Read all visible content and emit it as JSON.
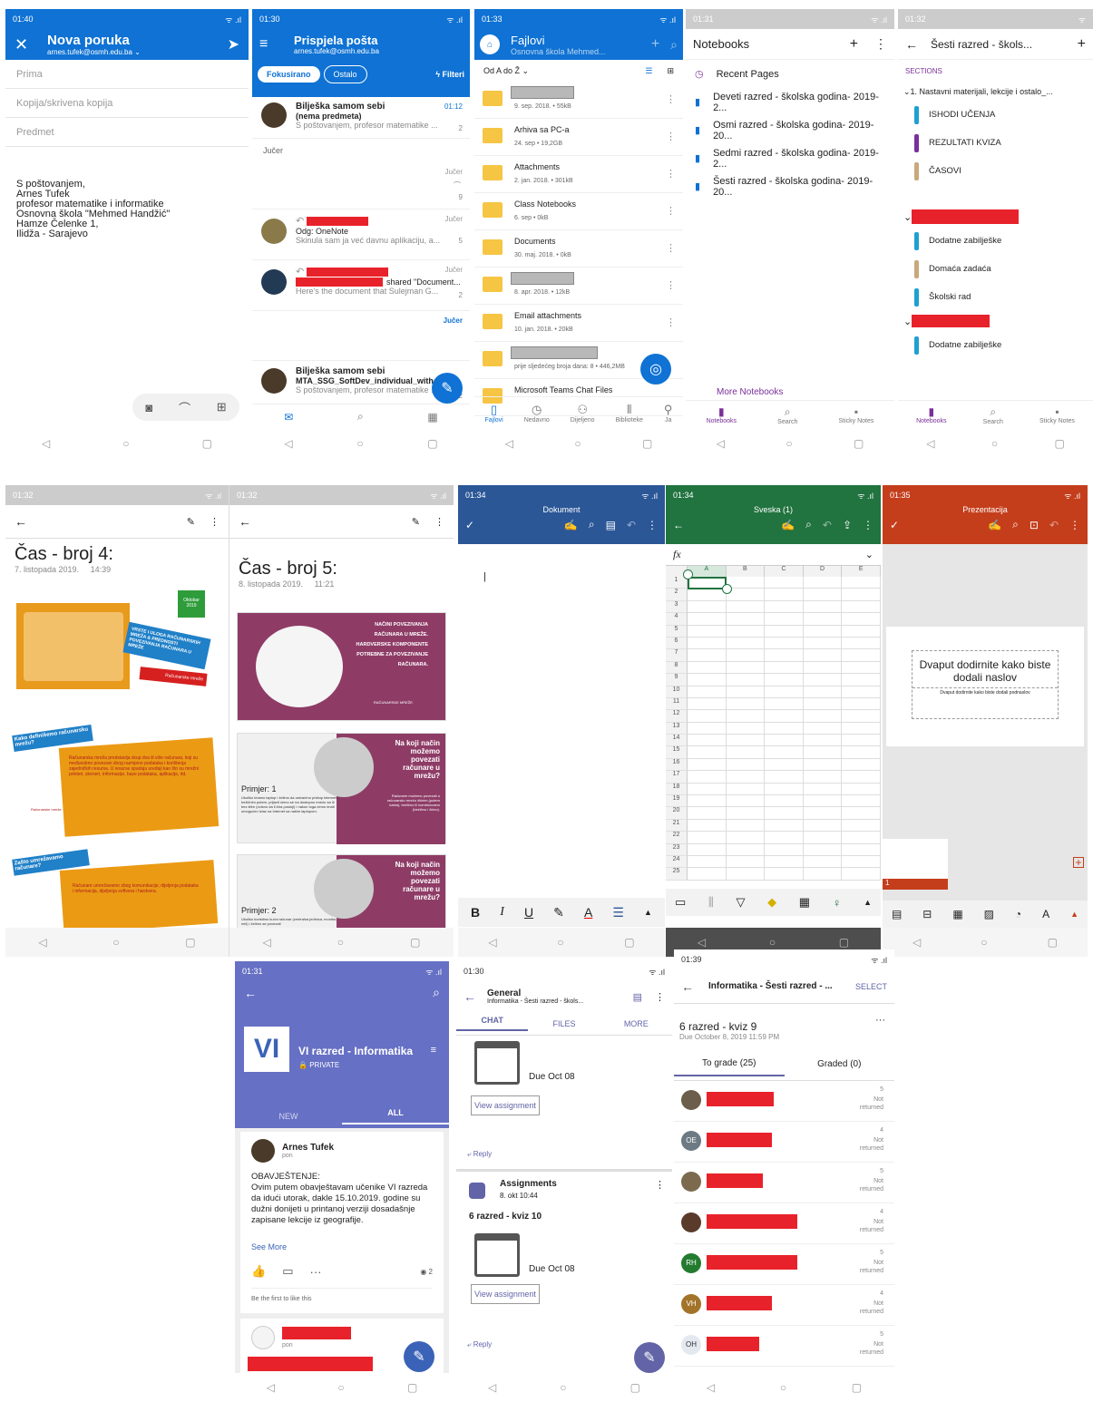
{
  "compose": {
    "time": "01:40",
    "title": "Nova poruka",
    "from": "arnes.tufek@osmh.edu.ba",
    "to": "Prima",
    "cc": "Kopija/skrivena kopija",
    "subject": "Predmet",
    "sig": [
      "S poštovanjem,",
      "Arnes Tufek",
      "profesor matematike i informatike",
      "Osnovna škola \"Mehmed Handžić\"",
      "Hamze Čelenke 1,",
      "Ilidža - Sarajevo"
    ]
  },
  "inbox": {
    "time": "01:30",
    "title": "Prispjela pošta",
    "account": "arnes.tufek@osmh.edu.ba",
    "tab1": "Fokusirano",
    "tab2": "Ostalo",
    "filter": "Filteri",
    "m1": {
      "from": "Bilješka samom sebi",
      "subj": "(nema predmeta)",
      "prev": "S poštovanjem, profesor matematike ...",
      "time": "01:12",
      "count": "2"
    },
    "section": "Jučer",
    "m2": {
      "time": "Jučer",
      "count": "9"
    },
    "m3": {
      "subj": "Odg: OneNote",
      "prev": "Skinula sam ja već davnu aplikaciju, a...",
      "time": "Jučer",
      "count": "5"
    },
    "m4": {
      "subj": "shared \"Document...",
      "prev": "Here's the document that Sulejman G...",
      "time": "Jučer",
      "count": "2"
    },
    "m5time": "Jučer",
    "m6": {
      "from": "Bilješka samom sebi",
      "subj": "MTA_SSG_SoftDev_individual_with...",
      "prev": "S poštovanjem, profesor matematike ...",
      "count": "2"
    }
  },
  "files": {
    "time": "01:33",
    "title": "Fajlovi",
    "sub": "Osnovna škola Mehmed...",
    "sort": "Od A do Ž",
    "items": [
      {
        "name": "",
        "meta": "9. sep. 2018. • 55kB",
        "blur": true
      },
      {
        "name": "Arhiva sa PC-a",
        "meta": "24. sep • 19,2GB"
      },
      {
        "name": "Attachments",
        "meta": "2. jan. 2018. • 301kB"
      },
      {
        "name": "Class Notebooks",
        "meta": "6. sep • 0kB"
      },
      {
        "name": "Documents",
        "meta": "30. maj. 2018. • 0kB"
      },
      {
        "name": "",
        "meta": "8. apr. 2018. • 12kB",
        "blur": true
      },
      {
        "name": "Email attachments",
        "meta": "10. jan. 2018. • 20kB"
      },
      {
        "name": "",
        "meta": "prije sljedećeg broja dana: 8 • 446,2MB",
        "blur": true
      },
      {
        "name": "Microsoft Teams Chat Files",
        "meta": ""
      }
    ],
    "nav": [
      "Fajlovi",
      "Nedavno",
      "Dijeljeno",
      "Biblioteke",
      "Ja"
    ]
  },
  "notebooks": {
    "time": "01:31",
    "title": "Notebooks",
    "items": [
      "Recent Pages",
      "Deveti razred - školska godina- 2019-2...",
      "Osmi razred - školska godina- 2019-20...",
      "Sedmi razred - školska godina- 2019-2...",
      "Šesti razred - školska godina- 2019-20..."
    ],
    "more": "More Notebooks",
    "nav": [
      "Notebooks",
      "Search",
      "Sticky Notes"
    ]
  },
  "sections": {
    "time": "01:32",
    "title": "Šesti razred - škols...",
    "label": "SECTIONS",
    "group1": "1. Nastavni materijali, lekcije i ostalo_...",
    "g1items": [
      "ISHODI UČENJA",
      "REZULTATI KVIZA",
      "ČASOVI"
    ],
    "g2items": [
      "Dodatne zabilješke",
      "Domaća zadaća",
      "Školski rad"
    ],
    "g3items": [
      "Dodatne zabilješke"
    ],
    "nav": [
      "Notebooks",
      "Search",
      "Sticky Notes"
    ],
    "colors": [
      "#1fa0d0",
      "#7a2f9a",
      "#c9a87b",
      "#1fa0d0",
      "#c9a87b",
      "#1fa0d0",
      "#1fa0d0"
    ]
  },
  "cas4": {
    "time": "01:32",
    "title": "Čas - broj 4:",
    "date": "7. listopada 2019.",
    "clock": "14:39",
    "s1": {
      "tag": "Oktobar 2019",
      "banner": "VRSTE I ULOGA RAČUNARSKIH MREŽA & PREDNOSTI POVEZIVANJA RAČUNARA U MREŽE",
      "red": "Računarske mreže"
    },
    "s2": {
      "banner": "Kako definišemo računarsku mrežu?",
      "text": "Računarska mreža predstavlja skup dva ili više računara, koji su međusobno povezani zbog razmjene podataka i korištenja zajedničkih resursa. U resurse spadaju uređaji kao što su mrežni printeri, skeneri, informacije, baze podataka, aplikacije, itd.",
      "foot": "Računarske mreže",
      "num": "2"
    },
    "s3": {
      "banner": "Zašto umrežavamo računare?",
      "text": "Računare umrežavamo zbog komunikacije, dijeljenja podataka i informacija, dijeljenja softvera i hardvera."
    }
  },
  "cas5": {
    "time": "01:32",
    "title": "Čas - broj 5:",
    "date": "8. listopada 2019.",
    "clock": "11:21",
    "s1": {
      "text": "NAČINI POVEZIVANJA RAČUNARA U MREŽE. HARDVERSKE KOMPONENTE POTREBNE ZA POVEZIVANJE RAČUNARA.",
      "foot": "RAČUNARSKE MREŽE"
    },
    "s2": {
      "q": "Na koji način možemo povezati računare u mrežu?",
      "label": "Primjer: 1",
      "text": "Ukoliko imamo laptop i želimo da ostvarimo pristup internetu bežičnim putem, prijavit ćemo se na dostupnu mrežu sa ili bez šifre (ovisno da li bira postoji) i nakon toga ćemo imati omogućen izlaz na Internet sa našim laptopom.",
      "small": "Računare možemo povezati u računarsku mrežu žičnim (putem kabla), bežično ili kombinovano (bežično i žično)."
    },
    "s3": {
      "q": "Na koji način možemo povezati računare u mrežu?",
      "label": "Primjer: 2",
      "text": "Ukoliko koristimo kućni računar (centralna jedinica, monitor, miš) i želimo se povezati"
    }
  },
  "word": {
    "time": "01:34",
    "title": "Dokument",
    "bar": [
      "B",
      "I",
      "U"
    ]
  },
  "excel": {
    "time": "01:34",
    "title": "Sveska (1)",
    "fx": "fx",
    "cols": [
      "A",
      "B",
      "C",
      "D",
      "E"
    ],
    "rows": [
      "1",
      "2",
      "3",
      "4",
      "5",
      "6",
      "7",
      "8",
      "9",
      "10",
      "11",
      "12",
      "13",
      "14",
      "15",
      "16",
      "17",
      "18",
      "19",
      "20",
      "21",
      "22",
      "23",
      "24",
      "25"
    ]
  },
  "ppt": {
    "time": "01:35",
    "title": "Prezentacija",
    "slideTitle": "Dvaput dodirnite kako biste dodali naslov",
    "slideSub": "Dvaput dodirnite kako biste dodali podnaslov",
    "thumb": "1"
  },
  "yammer": {
    "time": "01:31",
    "logo": "VI",
    "group": "VI razred - Informatika",
    "privacy": "PRIVATE",
    "tabs": [
      "NEW",
      "ALL"
    ],
    "author": "Arnes Tufek",
    "day": "pon",
    "body": [
      "OBAVJEŠTENJE:",
      "Ovim putem obavještavam učenike VI razreda da idući utorak, dakle 15.10.2019. godine su dužni donijeti u printanoj verziji dosadašnje zapisane lekcije iz geografije."
    ],
    "more": "See More",
    "seen": "2",
    "like": "Be the first to like this",
    "day2": "pon"
  },
  "teamsChat": {
    "time": "01:30",
    "channel": "General",
    "sub": "Informatika - Šesti razred - škols...",
    "tabs": [
      "CHAT",
      "FILES",
      "MORE"
    ],
    "due1": "Due Oct 08",
    "view": "View assignment",
    "reply": "Reply",
    "app": "Assignments",
    "appTime": "8. okt 10:44",
    "quiz": "6 razred - kviz 10",
    "due2": "Due Oct 08"
  },
  "grade": {
    "time": "01:39",
    "title": "Informatika - Šesti razred - ...",
    "select": "SELECT",
    "quiz": "6 razred - kviz 9",
    "due": "Due October 8, 2019 11:59 PM",
    "tab1": "To grade (25)",
    "tab2": "Graded (0)",
    "rows": [
      {
        "av": "",
        "pts": "5"
      },
      {
        "av": "OE",
        "pts": "4"
      },
      {
        "av": "",
        "pts": "5"
      },
      {
        "av": "",
        "pts": "4"
      },
      {
        "av": "RH",
        "pts": "5"
      },
      {
        "av": "VH",
        "pts": "4"
      },
      {
        "av": "OH",
        "pts": "5"
      }
    ],
    "status": "Not returned"
  }
}
